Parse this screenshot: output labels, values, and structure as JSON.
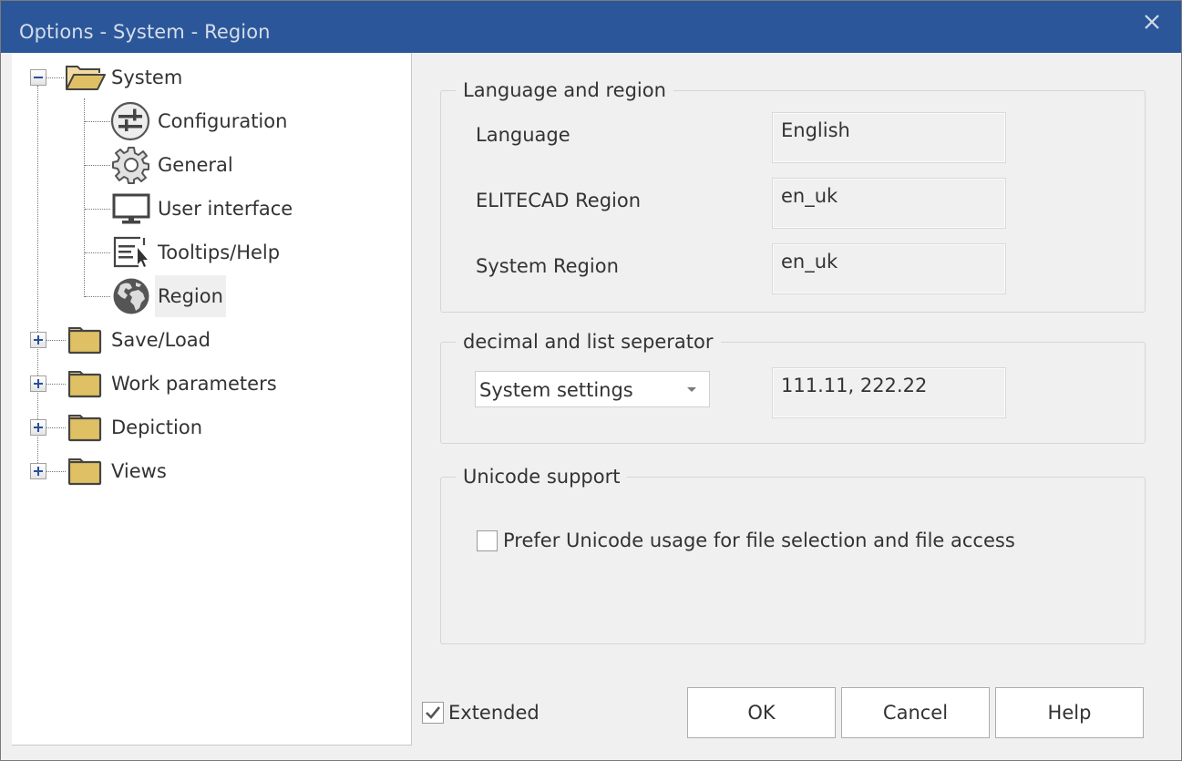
{
  "window": {
    "title": "Options - System - Region"
  },
  "titlebar": {
    "close_icon": "close-icon"
  },
  "colors": {
    "titlebar_bg": "#2b579a",
    "folder_fill": "#e0c064",
    "tree_selected_bg": "#efefef"
  },
  "tree": {
    "root": {
      "label": "System",
      "expanded": true,
      "icon": "folder-open-icon",
      "children": [
        {
          "label": "Configuration",
          "icon": "sliders-icon"
        },
        {
          "label": "General",
          "icon": "gear-icon"
        },
        {
          "label": "User interface",
          "icon": "monitor-icon"
        },
        {
          "label": "Tooltips/Help",
          "icon": "tooltip-cursor-icon"
        },
        {
          "label": "Region",
          "icon": "globe-icon",
          "selected": true
        }
      ]
    },
    "folders": [
      {
        "label": "Save/Load",
        "expanded": false,
        "icon": "folder-icon"
      },
      {
        "label": "Work parameters",
        "expanded": false,
        "icon": "folder-icon"
      },
      {
        "label": "Depiction",
        "expanded": false,
        "icon": "folder-icon"
      },
      {
        "label": "Views",
        "expanded": false,
        "icon": "folder-icon"
      }
    ]
  },
  "language_region": {
    "title": "Language and region",
    "rows": [
      {
        "label": "Language",
        "value": "English"
      },
      {
        "label": "ELITECAD Region",
        "value": "en_uk"
      },
      {
        "label": "System Region",
        "value": "en_uk"
      }
    ]
  },
  "separator": {
    "title": "decimal and list seperator",
    "dropdown_value": "System settings",
    "preview": "111.11, 222.22"
  },
  "unicode": {
    "title": "Unicode support",
    "checkbox_label": "Prefer Unicode usage for file selection and file access",
    "checked": false
  },
  "footer": {
    "extended_label": "Extended",
    "extended_checked": true,
    "ok": "OK",
    "cancel": "Cancel",
    "help": "Help"
  }
}
